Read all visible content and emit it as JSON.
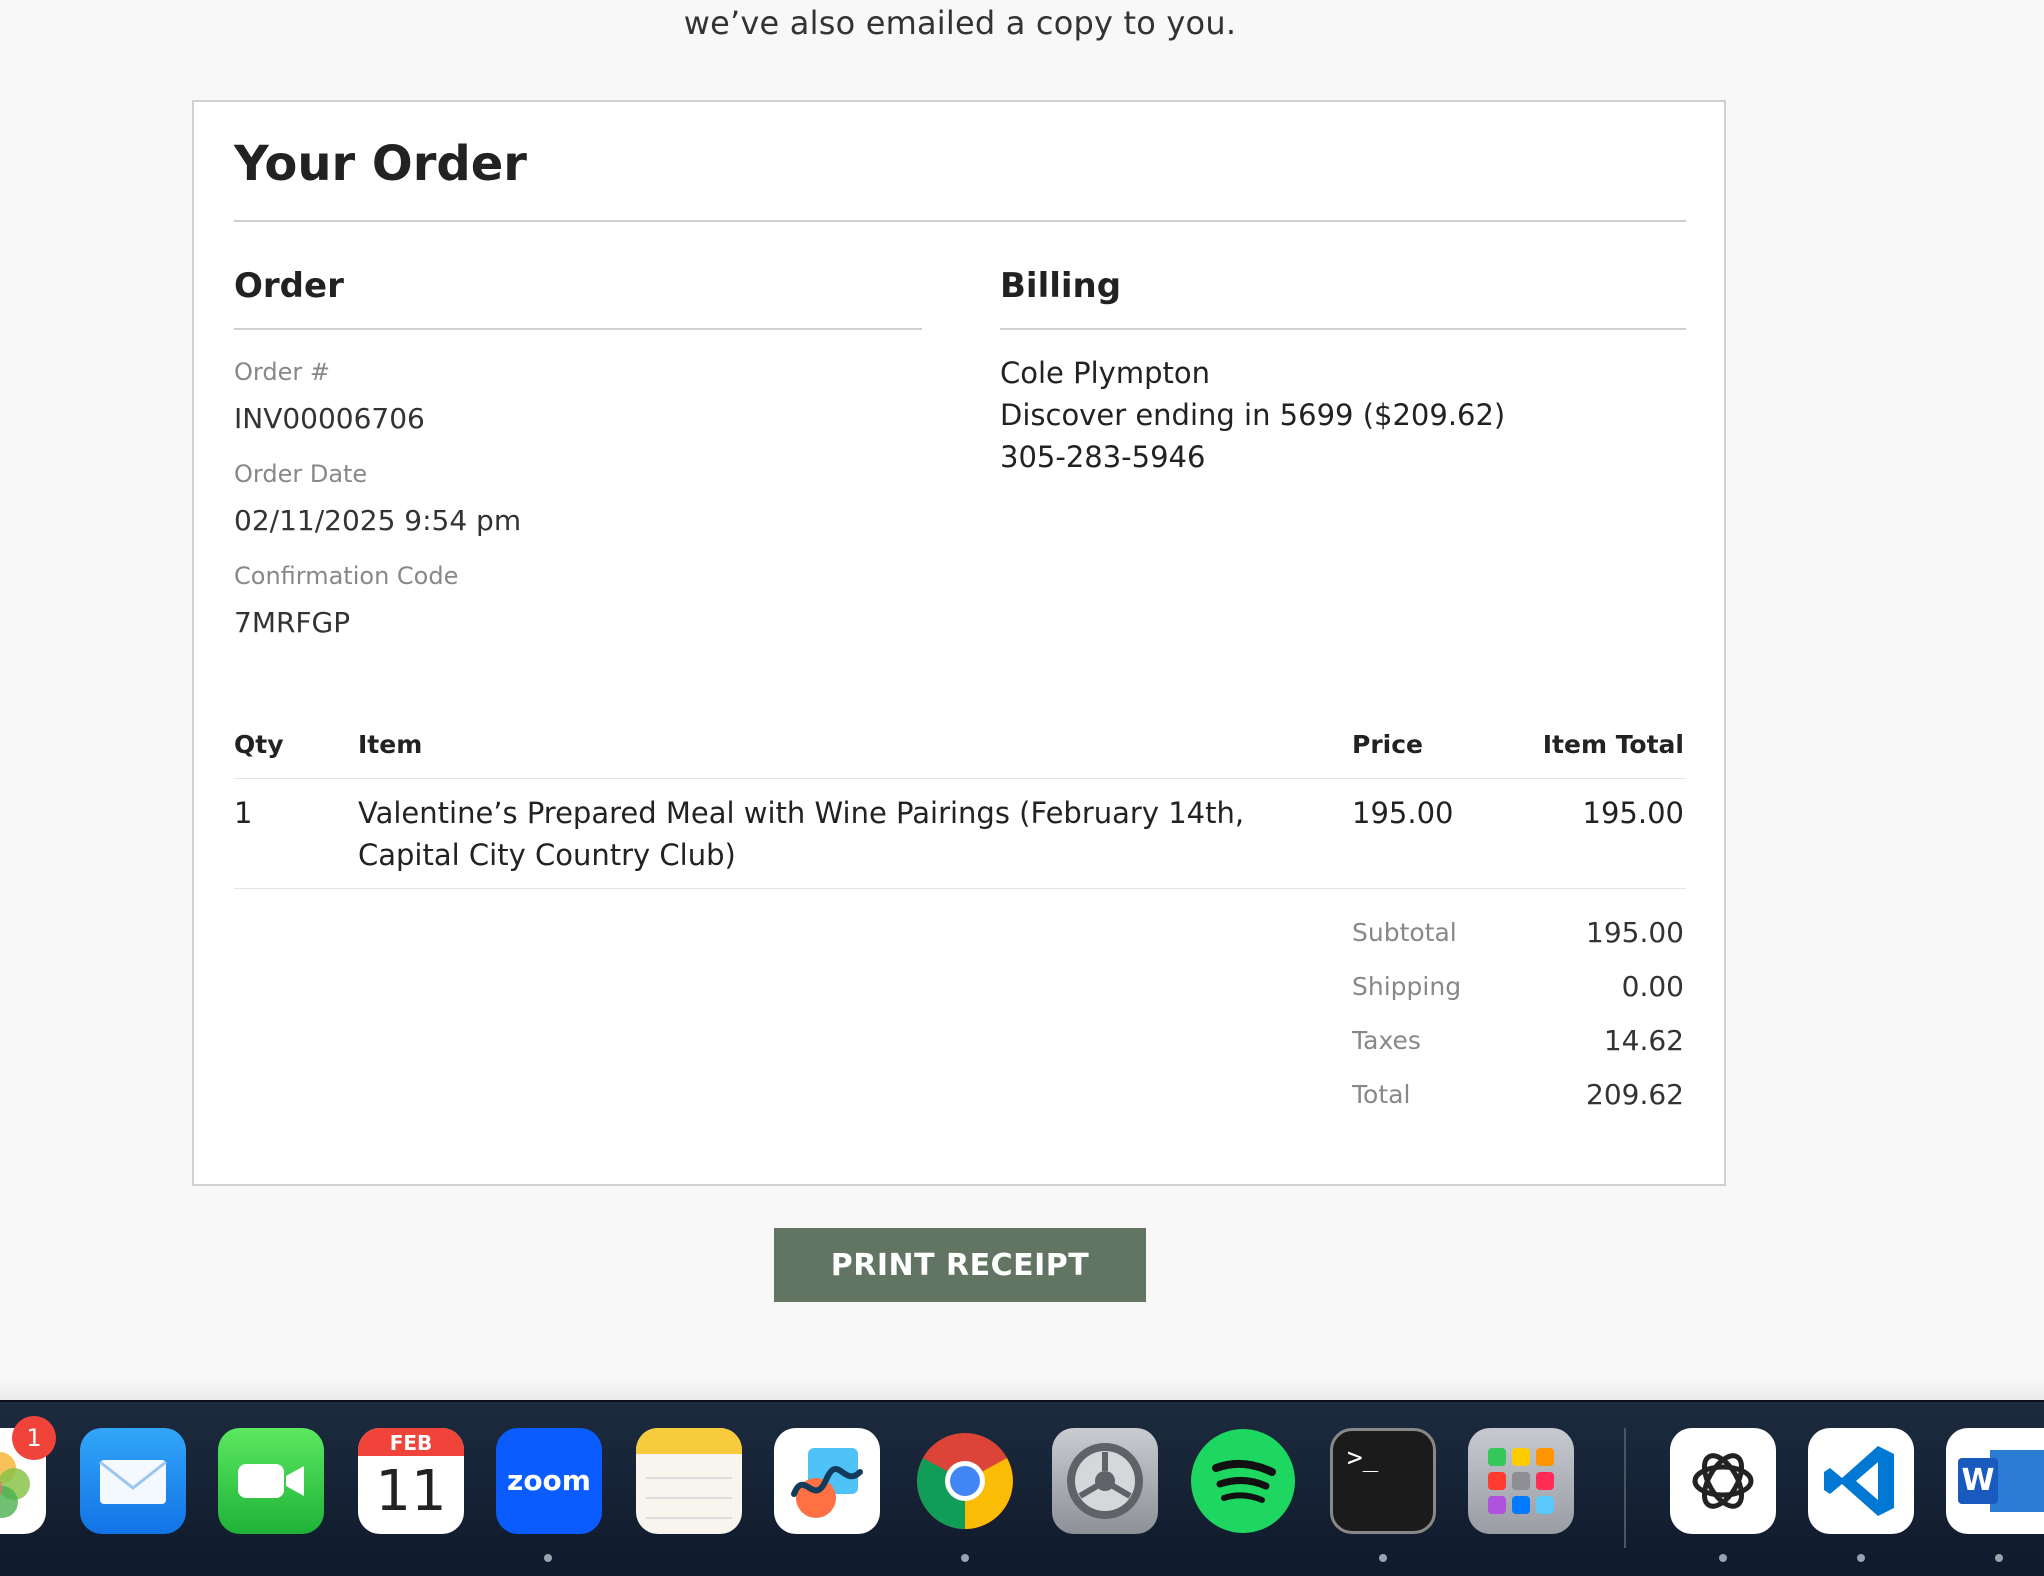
{
  "intro_text": "we’ve also emailed a copy to you.",
  "card": {
    "title": "Your Order",
    "order": {
      "heading": "Order",
      "order_num_label": "Order #",
      "order_num": "INV00006706",
      "date_label": "Order Date",
      "date": "02/11/2025 9:54 pm",
      "code_label": "Confirmation Code",
      "code": "7MRFGP"
    },
    "billing": {
      "heading": "Billing",
      "name": "Cole Plympton",
      "payment": "Discover ending in 5699 ($209.62)",
      "phone": "305-283-5946"
    },
    "table": {
      "headers": {
        "qty": "Qty",
        "item": "Item",
        "price": "Price",
        "total": "Item Total"
      },
      "rows": [
        {
          "qty": "1",
          "item_line1": "Valentine’s Prepared Meal with Wine Pairings (February 14th,",
          "item_line2": "Capital City Country Club)",
          "price": "195.00",
          "total": "195.00"
        }
      ]
    },
    "summary": {
      "subtotal_label": "Subtotal",
      "subtotal": "195.00",
      "shipping_label": "Shipping",
      "shipping": "0.00",
      "taxes_label": "Taxes",
      "taxes": "14.62",
      "total_label": "Total",
      "total": "209.62"
    }
  },
  "print_button": "PRINT RECEIPT",
  "dock": {
    "photos_badge": "1",
    "calendar_month": "FEB",
    "calendar_day": "11",
    "zoom_label": "zoom",
    "terminal_prompt": ">_",
    "word_letter": "W",
    "apps": [
      "photos-icon",
      "mail-icon",
      "facetime-icon",
      "calendar-icon",
      "zoom-icon",
      "notes-icon",
      "freeform-icon",
      "chrome-icon",
      "system-settings-icon",
      "spotify-icon",
      "terminal-icon",
      "launchpad-icon",
      "chatgpt-icon",
      "vscode-icon",
      "word-icon"
    ],
    "accent_colors": {
      "button": "#627562",
      "badge": "#f0443a",
      "spotify": "#1ed760"
    }
  }
}
